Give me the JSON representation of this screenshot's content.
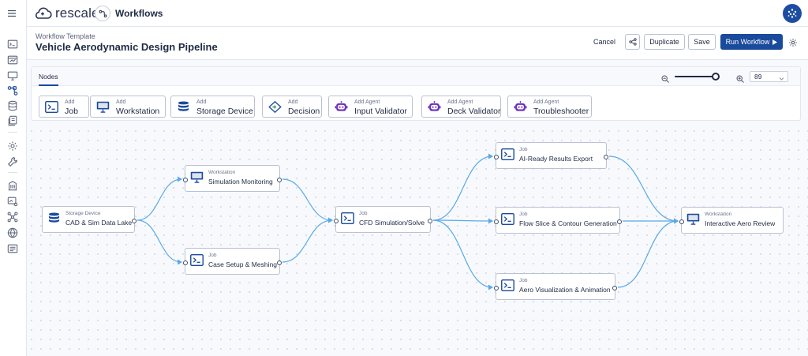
{
  "topbar": {
    "logo_text": "rescale",
    "app_title": "Workflows"
  },
  "header": {
    "subtitle": "Workflow Template",
    "title": "Vehicle Aerodynamic Design Pipeline",
    "cancel_label": "Cancel",
    "duplicate_label": "Duplicate",
    "save_label": "Save",
    "run_label": "Run Workflow"
  },
  "nodes_panel": {
    "tab_label": "Nodes",
    "zoom_value": "89",
    "zoom_level": 0.92,
    "add_buttons": [
      {
        "small": "Add",
        "big": "Job",
        "icon": "job-icon"
      },
      {
        "small": "Add",
        "big": "Workstation",
        "icon": "workstation-icon"
      },
      {
        "small": "Add",
        "big": "Storage Device",
        "icon": "storage-icon"
      },
      {
        "small": "Add",
        "big": "Decision",
        "icon": "decision-icon"
      },
      {
        "small": "Add Agent",
        "big": "Input Validator",
        "icon": "agent-icon"
      },
      {
        "small": "Add Agent",
        "big": "Deck Validator",
        "icon": "agent-icon"
      },
      {
        "small": "Add Agent",
        "big": "Troubleshooter",
        "icon": "agent-icon"
      }
    ]
  },
  "graph": {
    "nodes": [
      {
        "id": "storage",
        "type": "Storage Device",
        "label": "CAD & Sim Data Lake",
        "icon": "storage-icon"
      },
      {
        "id": "monitor",
        "type": "Workstation",
        "label": "Simulation Monitoring",
        "icon": "workstation-icon"
      },
      {
        "id": "mesh",
        "type": "Job",
        "label": "Case Setup & Meshing",
        "icon": "job-icon"
      },
      {
        "id": "cfd",
        "type": "Job",
        "label": "CFD Simulation/Solve",
        "icon": "job-icon"
      },
      {
        "id": "export",
        "type": "Job",
        "label": "AI-Ready Results Export",
        "icon": "job-icon"
      },
      {
        "id": "slice",
        "type": "Job",
        "label": "Flow Slice & Contour Generation",
        "icon": "job-icon"
      },
      {
        "id": "viz",
        "type": "Job",
        "label": "Aero Visualization & Animation",
        "icon": "job-icon"
      },
      {
        "id": "review",
        "type": "Workstation",
        "label": "Interactive Aero Review",
        "icon": "workstation-icon"
      }
    ],
    "edges": [
      [
        "storage",
        "monitor"
      ],
      [
        "storage",
        "mesh"
      ],
      [
        "monitor",
        "cfd"
      ],
      [
        "mesh",
        "cfd"
      ],
      [
        "cfd",
        "export"
      ],
      [
        "cfd",
        "slice"
      ],
      [
        "cfd",
        "viz"
      ],
      [
        "export",
        "review"
      ],
      [
        "slice",
        "review"
      ],
      [
        "viz",
        "review"
      ]
    ]
  },
  "colors": {
    "brand": "#1a4a9c",
    "edge": "#5aa9e6",
    "agent": "#6b2fbf"
  }
}
